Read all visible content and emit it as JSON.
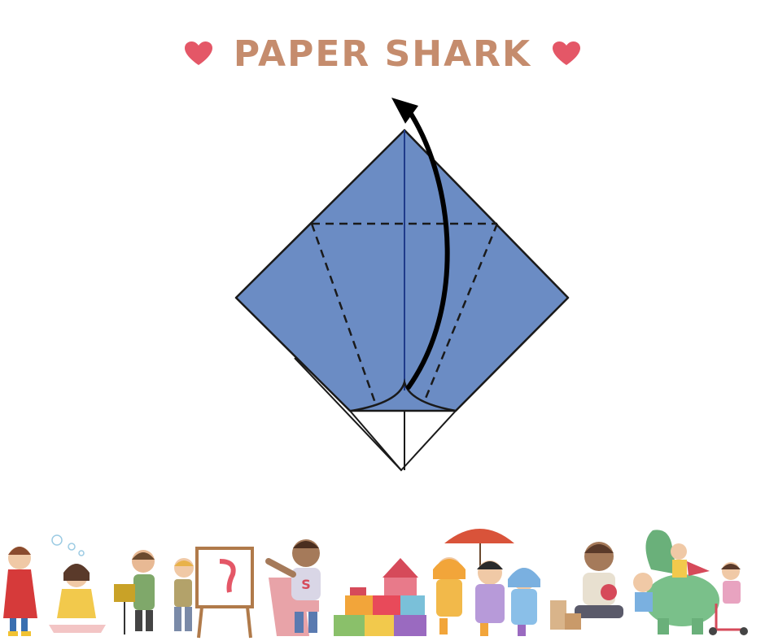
{
  "title": "PAPER SHARK",
  "colors": {
    "title": "#c58c6d",
    "heart": "#e45767",
    "paper": "#6b8cc4",
    "paper_edge": "#2a2a2a",
    "crease": "#1f3b8a"
  },
  "icons": {
    "left": "heart-icon",
    "right": "heart-icon",
    "arrow": "curved-arrow-up"
  }
}
